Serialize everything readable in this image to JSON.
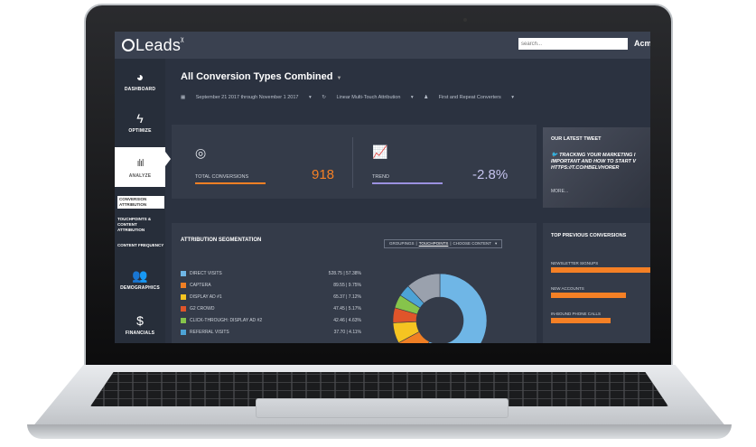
{
  "app": {
    "logo": "Leads",
    "search_placeholder": "search...",
    "account": "Acm"
  },
  "sidebar": {
    "items": [
      {
        "label": "DASHBOARD",
        "icon": "gauge-icon",
        "glyph": "◕"
      },
      {
        "label": "OPTIMIZE",
        "icon": "lightning-icon",
        "glyph": "ϟ"
      },
      {
        "label": "ANALYZE",
        "icon": "bar-chart-icon",
        "glyph": "ılıl"
      },
      {
        "label": "DEMOGRAPHICS",
        "icon": "people-icon",
        "glyph": "👥"
      },
      {
        "label": "FINANCIALS",
        "icon": "dollar-icon",
        "glyph": "$"
      }
    ],
    "subitems": [
      "CONVERSION ATTRIBUTION",
      "TOUCHPOINTS & CONTENT ATTRIBUTION",
      "CONTENT FREQUENCY"
    ]
  },
  "main": {
    "title": "All Conversion Types Combined",
    "filters": [
      "September 21 2017 through November 1 2017",
      "Linear Multi-Touch Attribution",
      "First and Repeat Converters"
    ]
  },
  "kpis": [
    {
      "label": "TOTAL CONVERSIONS",
      "value": "918",
      "icon": "target-icon"
    },
    {
      "label": "TREND",
      "value": "-2.8%",
      "icon": "trend-icon"
    }
  ],
  "tweet": {
    "heading": "OUR LATEST TWEET",
    "text": "TRACKING YOUR MARKETING I IMPORTANT AND HOW TO START V HTTPS://T.CO/HBELVHORER",
    "more": "MORE..."
  },
  "segmentation": {
    "heading": "ATTRIBUTION SEGMENTATION",
    "tabs": [
      "GROUPINGS",
      "TOUCHPOINTS",
      "CHOOSE CONTENT"
    ],
    "rows": [
      {
        "name": "DIRECT VISITS",
        "value": "528.75 | 57.38%",
        "color": "#6fb6e6",
        "pct": 57.38
      },
      {
        "name": "CAPTERA",
        "value": "89.55 | 9.75%",
        "color": "#f07f24",
        "pct": 9.75
      },
      {
        "name": "DISPLAY AD #1",
        "value": "65.37 | 7.12%",
        "color": "#f5c421",
        "pct": 7.12
      },
      {
        "name": "G2 CROWD",
        "value": "47.45 | 5.17%",
        "color": "#e0552a",
        "pct": 5.17
      },
      {
        "name": "CLICK-THROUGH: DISPLAY AD #2",
        "value": "42.46 | 4.63%",
        "color": "#86c44b",
        "pct": 4.63
      },
      {
        "name": "REFERRAL VISITS",
        "value": "37.70 | 4.11%",
        "color": "#4da3d6",
        "pct": 4.11
      }
    ]
  },
  "previous": {
    "heading": "TOP PREVIOUS CONVERSIONS",
    "items": [
      {
        "label": "NEWSLETTER SIGNUPS",
        "level": 1.0
      },
      {
        "label": "NEW ACCOUNTS",
        "level": 0.75
      },
      {
        "label": "IN-BOUND PHONE CALLS",
        "level": 0.6
      }
    ]
  }
}
